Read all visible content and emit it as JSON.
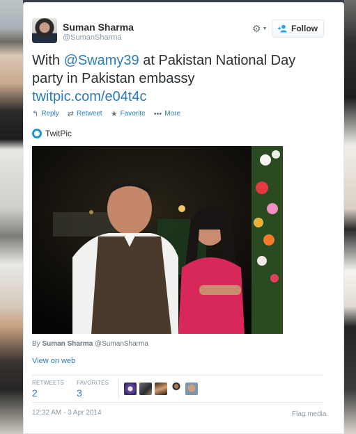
{
  "user": {
    "name": "Suman Sharma",
    "handle": "@SumanSharma"
  },
  "header": {
    "follow_label": "Follow",
    "gear_icon": "gear-icon",
    "follow_icon": "add-person-icon"
  },
  "tweet": {
    "text_before": "With ",
    "mention": "@Swamy39",
    "text_after": " at Pakistan National Day party in Pakistan embassy ",
    "link": "twitpic.com/e04t4c"
  },
  "actions": [
    {
      "icon": "reply-icon",
      "glyph": "↰",
      "label": "Reply"
    },
    {
      "icon": "retweet-icon",
      "glyph": "⇄",
      "label": "Retweet"
    },
    {
      "icon": "star-icon",
      "glyph": "★",
      "label": "Favorite"
    },
    {
      "icon": "more-icon",
      "glyph": "•••",
      "label": "More"
    }
  ],
  "media": {
    "provider": "TwitPic",
    "by_prefix": "By",
    "by_name": "Suman Sharma",
    "by_handle": "@SumanSharma",
    "view_on_web": "View on web"
  },
  "stats": {
    "retweets_label": "RETWEETS",
    "retweets_value": "2",
    "favorites_label": "FAVORITES",
    "favorites_value": "3"
  },
  "footer": {
    "timestamp": "12:32 AM - 3 Apr 2014",
    "flag_label": "Flag media"
  },
  "colors": {
    "link": "#2b7bb9",
    "text": "#292f33",
    "muted": "#8899a6"
  }
}
